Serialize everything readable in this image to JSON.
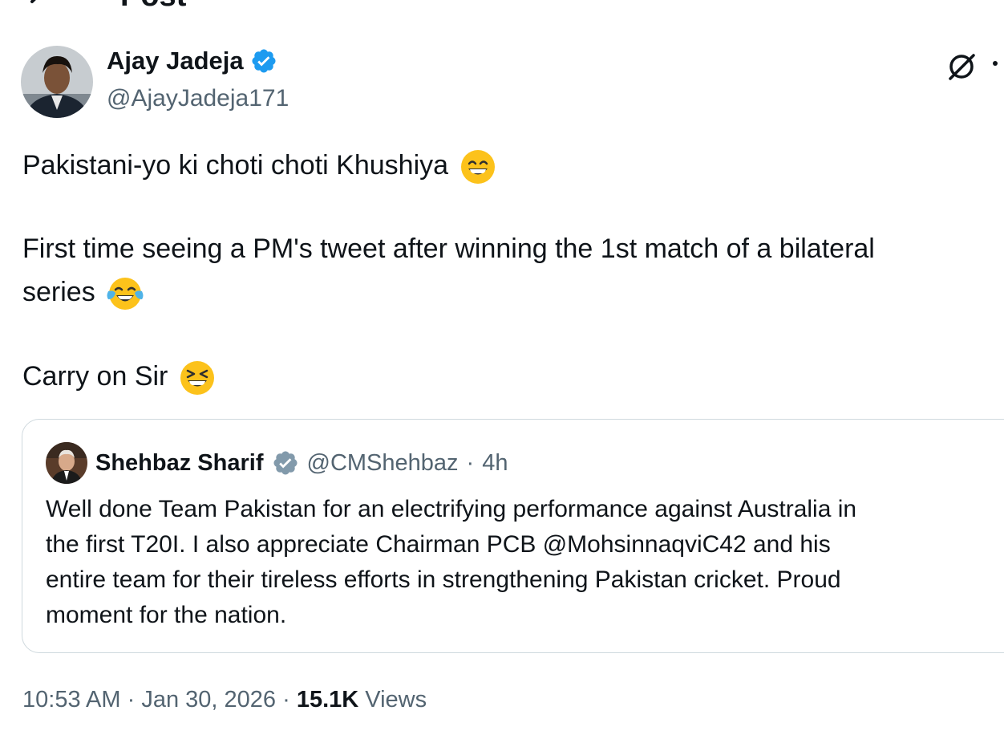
{
  "header": {
    "title": "Post",
    "back_icon": "arrow-left-icon"
  },
  "author": {
    "name": "Ajay Jadeja",
    "handle": "@AjayJadeja171",
    "verified_icon": "verified-badge-icon",
    "verified_color": "#1d9bf0"
  },
  "actions": {
    "grok_icon": "grok-icon",
    "more_icon": "more-options-icon"
  },
  "tweet": {
    "line1": "Pakistani-yo ki choti choti Khushiya",
    "line1_emoji": "grinning-smiling-eyes-emoji",
    "line2a": "First time seeing a PM's tweet after winning the 1st match of a bilateral",
    "line2b": "series",
    "line2_emoji": "tears-of-joy-emoji",
    "line3": "Carry on Sir",
    "line3_emoji": "squinting-laughing-emoji"
  },
  "quote": {
    "name": "Shehbaz Sharif",
    "verified_icon": "government-verified-badge-icon",
    "verified_color": "#829aab",
    "handle": "@CMShehbaz",
    "separator": "·",
    "time": "4h",
    "body_lines": [
      "Well done Team Pakistan for an electrifying performance against Australia in",
      "the first T20I. I also appreciate Chairman PCB @MohsinnaqviC42 and his",
      "entire team for their tireless efforts in strengthening Pakistan cricket. Proud",
      "moment for the nation."
    ]
  },
  "meta": {
    "time": "10:53 AM",
    "sep1": "·",
    "date": "Jan 30, 2026",
    "sep2": "·",
    "views_count": "15.1K",
    "views_label": "Views"
  },
  "colors": {
    "text": "#0f1419",
    "secondary": "#536471",
    "border": "#cfd9de"
  }
}
